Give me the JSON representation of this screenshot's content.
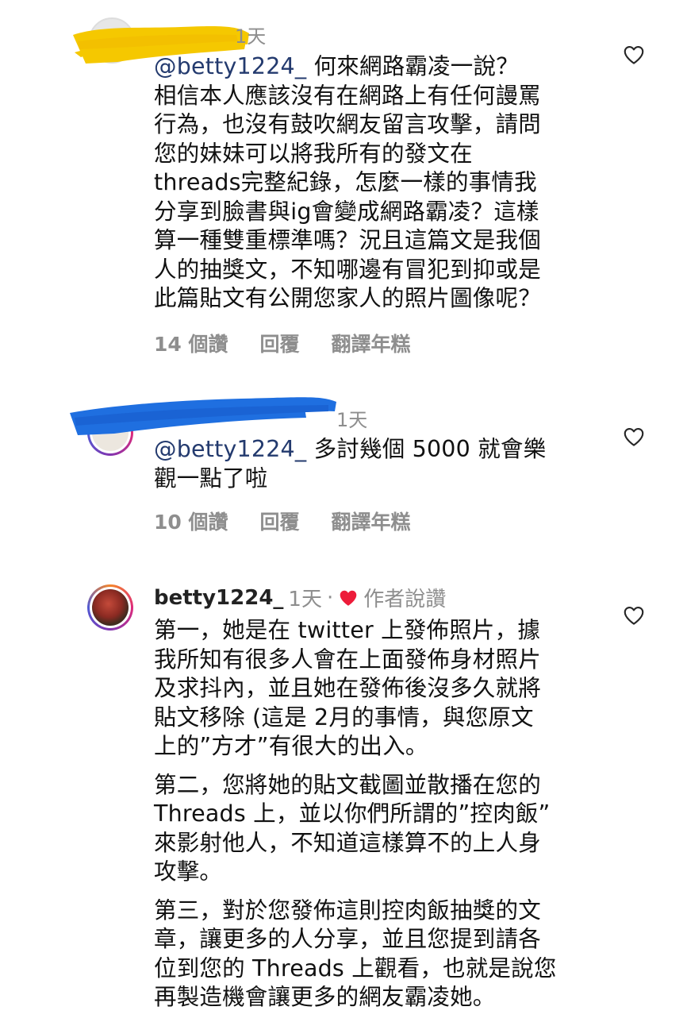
{
  "comments": [
    {
      "time": "1天",
      "mention": "@betty1224_",
      "lines": [
        " 何來網路霸凌一說？",
        "相信本人應該沒有在網路上有任何謾罵",
        "行為，也沒有鼓吹網友留言攻擊，請問",
        "您的妹妹可以將我所有的發文在",
        "threads完整紀錄，怎麼一樣的事情我",
        "分享到臉書與ig會變成網路霸凌？這樣",
        "算一種雙重標準嗎？況且這篇文是我個",
        "人的抽獎文，不知哪邊有冒犯到抑或是",
        "此篇貼文有公開您家人的照片圖像呢？"
      ],
      "likes": "14 個讚",
      "reply": "回覆",
      "translate": "翻譯年糕"
    },
    {
      "time": "1天",
      "mention": "@betty1224_",
      "lines": [
        " 多討幾個 5000 就會樂",
        "觀一點了啦"
      ],
      "likes": "10 個讚",
      "reply": "回覆",
      "translate": "翻譯年糕"
    },
    {
      "username": "betty1224_",
      "time": "1天",
      "dot": "·",
      "author_liked": "作者說讚",
      "paragraphs": [
        [
          "第一，她是在 twitter 上發佈照片，據",
          "我所知有很多人會在上面發佈身材照片",
          "及求抖內，並且她在發佈後沒多久就將",
          "貼文移除 (這是 2月的事情，與您原文",
          "上的”方才”有很大的出入。"
        ],
        [
          "第二，您將她的貼文截圖並散播在您的",
          "Threads 上，並以你們所謂的”控肉飯”",
          "來影射他人，不知道這樣算不的上人身",
          "攻擊。"
        ],
        [
          "第三，對於您發佈這則控肉飯抽獎的文",
          "章，讓更多的人分享，並且您提到請各",
          "位到您的 Threads 上觀看，也就是說您",
          "再製造機會讓更多的網友霸凌她。"
        ]
      ]
    }
  ],
  "icons": {
    "like": "heart-outline-icon",
    "author_like": "heart-filled-icon"
  },
  "colors": {
    "mention": "#233a6e",
    "muted": "#8e8e8e",
    "heart_red": "#ed1c3a",
    "yellow_redaction": "#f5c800",
    "blue_redaction": "#1f6fe0"
  }
}
